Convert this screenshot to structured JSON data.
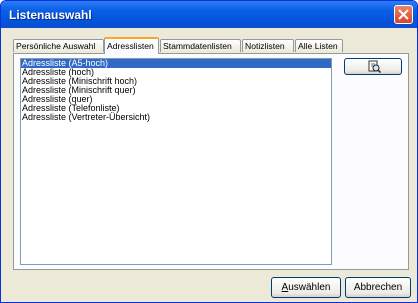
{
  "window": {
    "title": "Listenauswahl"
  },
  "tabs": [
    {
      "label": "Persönliche Auswahl",
      "active": false
    },
    {
      "label": "Adresslisten",
      "active": true
    },
    {
      "label": "Stammdatenlisten",
      "active": false
    },
    {
      "label": "Notizlisten",
      "active": false
    },
    {
      "label": "Alle Listen",
      "active": false
    }
  ],
  "list": {
    "items": [
      "Adressliste (A5-hoch)",
      "Adressliste (hoch)",
      "Adressliste (Minischrift hoch)",
      "Adressliste (Minischrift quer)",
      "Adressliste (quer)",
      "Adressliste (Telefonliste)",
      "Adressliste (Vertreter-Übersicht)"
    ],
    "selected_index": 0
  },
  "side_button": {
    "icon": "print-preview-icon"
  },
  "buttons": {
    "select_accel": "A",
    "select_rest": "uswählen",
    "cancel_label": "Abbrechen"
  },
  "colors": {
    "titlebar": "#0a5fe6",
    "selection": "#316ac5",
    "tab_highlight": "#f9a825",
    "close_button": "#d9432a"
  }
}
